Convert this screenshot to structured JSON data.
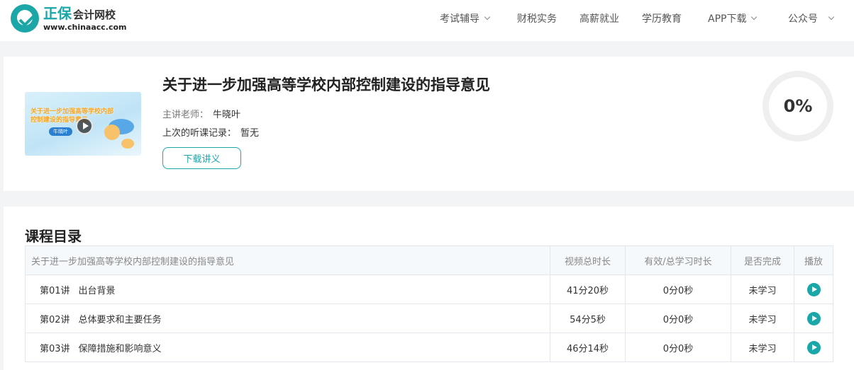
{
  "header": {
    "brand_name": "正保",
    "brand_sub": "会计网校",
    "brand_url": "www.chinaacc.com",
    "nav": [
      {
        "label": "考试辅导",
        "has_dropdown": true
      },
      {
        "label": "财税实务",
        "has_dropdown": false
      },
      {
        "label": "高薪就业",
        "has_dropdown": false
      },
      {
        "label": "学历教育",
        "has_dropdown": false
      },
      {
        "label": "APP下载",
        "has_dropdown": true
      },
      {
        "label": "公众号",
        "has_dropdown": true
      }
    ]
  },
  "course": {
    "thumbnail": {
      "title_line": "关于进一步加强高等学校内部控制建设的指导意见",
      "teacher": "牛晓叶",
      "icon": "play-icon"
    },
    "title": "关于进一步加强高等学校内部控制建设的指导意见",
    "teacher_label": "主讲老师：",
    "teacher_name": "牛晓叶",
    "last_record_label": "上次的听课记录：",
    "last_record_value": "暂无",
    "download_label": "下载讲义",
    "progress_percent": 0,
    "progress_text": "0%"
  },
  "catalog": {
    "title": "课程目录",
    "columns": [
      "关于进一步加强高等学校内部控制建设的指导意见",
      "视频总时长",
      "有效/总学习时长",
      "是否完成",
      "播放"
    ],
    "rows": [
      {
        "lecture": "第01讲",
        "name": "出台背景",
        "duration": "41分20秒",
        "studied": "0分0秒",
        "status": "未学习",
        "play_icon": "play-circle-icon"
      },
      {
        "lecture": "第02讲",
        "name": "总体要求和主要任务",
        "duration": "54分5秒",
        "studied": "0分0秒",
        "status": "未学习",
        "play_icon": "play-circle-icon"
      },
      {
        "lecture": "第03讲",
        "name": "保障措施和影响意义",
        "duration": "46分14秒",
        "studied": "0分0秒",
        "status": "未学习",
        "play_icon": "play-circle-icon"
      }
    ]
  },
  "colors": {
    "accent": "#1ba6a8",
    "page_bg": "#f3f4f6",
    "ring": "#efefef"
  }
}
